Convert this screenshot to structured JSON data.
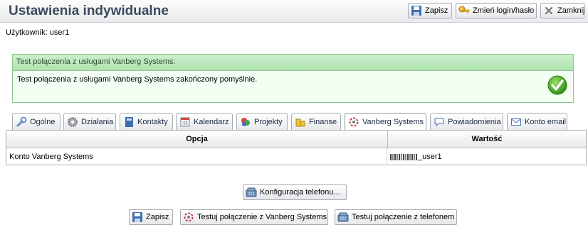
{
  "header": {
    "title": "Ustawienia indywidualne",
    "buttons": {
      "save": "Zapisz",
      "change_login": "Zmień login/hasło",
      "close": "Zamknij"
    }
  },
  "user": {
    "label": "Użytkownik:",
    "name": "user1"
  },
  "status_panel": {
    "title": "Test połączenia z usługami Vanberg Systems:",
    "message": "Test połączenia z usługami Vanberg Systems zakończony pomyślnie.",
    "icon": "success-check-icon"
  },
  "tabs": [
    {
      "label": "Ogólne",
      "icon": "wrench-icon"
    },
    {
      "label": "Działania",
      "icon": "gear-icon"
    },
    {
      "label": "Kontakty",
      "icon": "address-book-icon"
    },
    {
      "label": "Kalendarz",
      "icon": "calendar-icon"
    },
    {
      "label": "Projekty",
      "icon": "projects-icon"
    },
    {
      "label": "Finanse",
      "icon": "coins-icon"
    },
    {
      "label": "Vanberg Systems",
      "icon": "vanberg-icon",
      "active": true
    },
    {
      "label": "Powiadomienia",
      "icon": "speech-bubble-icon"
    },
    {
      "label": "Konto email",
      "icon": "envelope-icon"
    }
  ],
  "table": {
    "columns": [
      "Opcja",
      "Wartość"
    ],
    "rows": [
      {
        "option": "Konto Vanberg Systems",
        "value": "_user1"
      }
    ]
  },
  "buttons": {
    "phone_config": "Konfiguracja telefonu...",
    "save": "Zapisz",
    "test_vanberg": "Testuj połączenie z Vanberg Systems",
    "test_phone": "Testuj połączenie z telefonem"
  },
  "colors": {
    "panel_border": "#8fc58f",
    "panel_header": "#aee3ae",
    "title": "#3a4a5e"
  }
}
